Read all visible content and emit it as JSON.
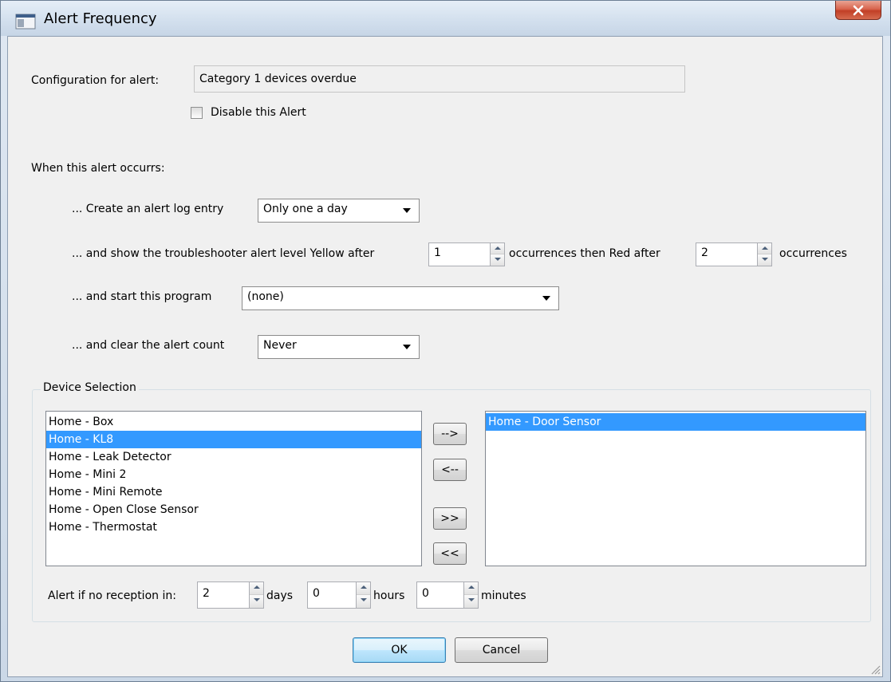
{
  "window": {
    "title": "Alert Frequency",
    "icons": {
      "app": "app-window-icon",
      "close": "close-icon"
    }
  },
  "config": {
    "label": "Configuration for alert:",
    "value": "Category 1 devices overdue",
    "disable_label": "Disable this Alert",
    "disabled": false
  },
  "occurs": {
    "heading": "When this alert occurrs:",
    "log_entry_label": "... Create an alert log entry",
    "log_entry_value": "Only one a day",
    "troubleshooter_label": "... and show the troubleshooter alert level Yellow after",
    "yellow_value": "1",
    "then_red_label": "occurrences then Red after",
    "red_value": "2",
    "occurrences_label": "occurrences",
    "program_label": "... and start this program",
    "program_value": "(none)",
    "clear_label": "... and clear the alert count",
    "clear_value": "Never"
  },
  "device_selection": {
    "title": "Device Selection",
    "available": [
      "Home - Box",
      "Home - KL8",
      "Home - Leak Detector",
      "Home - Mini 2",
      "Home - Mini Remote",
      "Home - Open Close Sensor",
      "Home - Thermostat"
    ],
    "available_selected_index": 1,
    "selected": [
      "Home - Door Sensor"
    ],
    "selected_selected_index": 0,
    "buttons": {
      "add": "-->",
      "remove": "<--",
      "add_all": ">>",
      "remove_all": "<<"
    },
    "reception": {
      "label": "Alert if no reception in:",
      "days_value": "2",
      "days_label": "days",
      "hours_value": "0",
      "hours_label": "hours",
      "minutes_value": "0",
      "minutes_label": "minutes"
    }
  },
  "footer": {
    "ok_label": "OK",
    "cancel_label": "Cancel"
  },
  "colors": {
    "selection": "#3399ff",
    "close_button": "#c13f26",
    "dialog_bg": "#f0f0f0"
  }
}
